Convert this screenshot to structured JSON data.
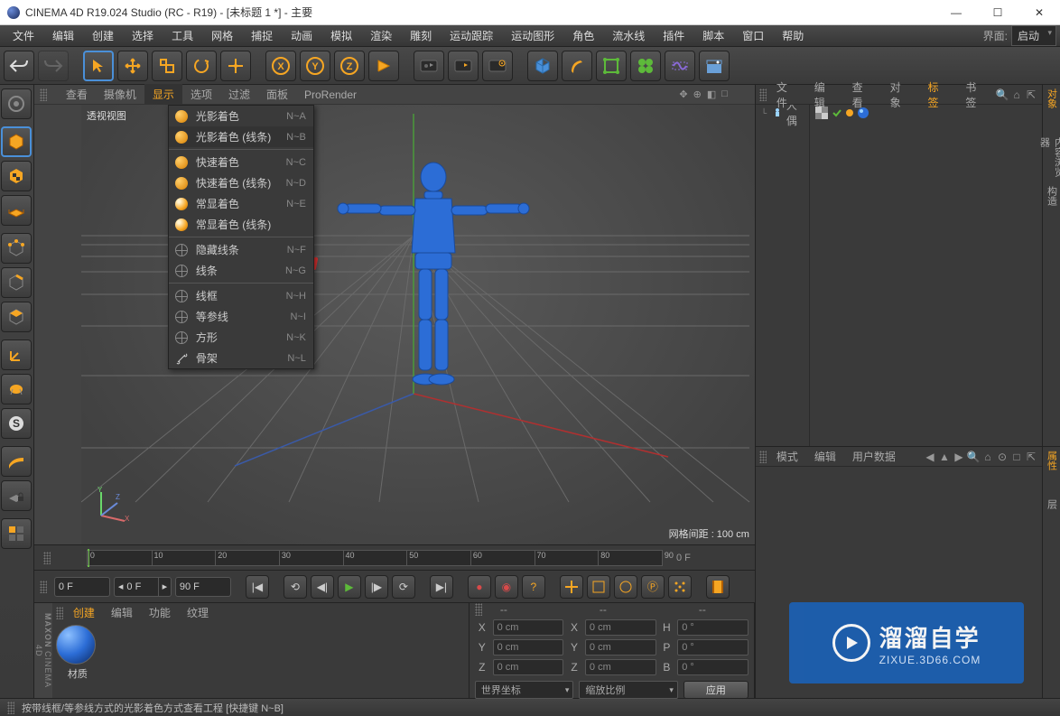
{
  "window": {
    "title": "CINEMA 4D R19.024 Studio (RC - R19) - [未标题 1 *] - 主要",
    "min": "—",
    "max": "☐",
    "close": "✕"
  },
  "menu": {
    "items": [
      "文件",
      "编辑",
      "创建",
      "选择",
      "工具",
      "网格",
      "捕捉",
      "动画",
      "模拟",
      "渲染",
      "雕刻",
      "运动跟踪",
      "运动图形",
      "角色",
      "流水线",
      "插件",
      "脚本",
      "窗口",
      "帮助"
    ],
    "iface_label": "界面:",
    "iface_value": "启动"
  },
  "vp_menu": {
    "items": [
      "查看",
      "摄像机",
      "显示",
      "选项",
      "过滤",
      "面板",
      "ProRender"
    ],
    "active": 2,
    "icons": [
      "✥",
      "⊕",
      "◧",
      "□"
    ]
  },
  "viewport": {
    "title": "透视视图",
    "grid_dist": "网格间距 : 100 cm",
    "axes": {
      "x": "X",
      "y": "Y",
      "z": "Z"
    }
  },
  "display_menu": [
    {
      "label": "光影着色",
      "short": "N~A",
      "icon": "shade",
      "checked": false
    },
    {
      "label": "光影着色 (线条)",
      "short": "N~B",
      "icon": "shade",
      "checked": true
    },
    {
      "sep": true
    },
    {
      "label": "快速着色",
      "short": "N~C",
      "icon": "shade"
    },
    {
      "label": "快速着色 (线条)",
      "short": "N~D",
      "icon": "shade"
    },
    {
      "label": "常显着色",
      "short": "N~E",
      "icon": "shadel"
    },
    {
      "label": "常显着色 (线条)",
      "short": "",
      "icon": "shadel"
    },
    {
      "sep": true
    },
    {
      "label": "隐藏线条",
      "short": "N~F",
      "icon": "globe"
    },
    {
      "label": "线条",
      "short": "N~G",
      "icon": "globe"
    },
    {
      "sep": true
    },
    {
      "label": "线框",
      "short": "N~H",
      "icon": "globe"
    },
    {
      "label": "等参线",
      "short": "N~I",
      "icon": "globe"
    },
    {
      "label": "方形",
      "short": "N~K",
      "icon": "globe"
    },
    {
      "label": "骨架",
      "short": "N~L",
      "icon": "bone"
    }
  ],
  "objects": {
    "tabs": [
      "文件",
      "编辑",
      "查看",
      "对象",
      "标签",
      "书签"
    ],
    "active": 4,
    "icons": [
      "🔍",
      "⌂",
      "⇱"
    ],
    "tree": [
      {
        "name": "人偶",
        "tags": [
          "grey-checker",
          "green-check",
          "blue-sphere"
        ]
      }
    ]
  },
  "attr": {
    "tabs": [
      "模式",
      "编辑",
      "用户数据"
    ],
    "nav": [
      "◀",
      "▲",
      "▶"
    ],
    "icons": [
      "🔍",
      "⌂",
      "⊙",
      "□",
      "⇱"
    ]
  },
  "sidetabs": [
    "对象",
    "内容浏览器",
    "构造"
  ],
  "sidetabs2": [
    "属性",
    "层"
  ],
  "timeline": {
    "ticks": [
      0,
      10,
      20,
      30,
      40,
      50,
      60,
      70,
      80,
      90
    ],
    "cursor_frame": "0 F"
  },
  "playbar": {
    "frame_start": "0 F",
    "frame_nudge": "0 F",
    "frame_end": "90 F"
  },
  "materials": {
    "tabs": [
      "创建",
      "编辑",
      "功能",
      "纹理"
    ],
    "active": 0,
    "item_label": "材质"
  },
  "coords": {
    "dashes": "--",
    "rows": [
      {
        "axis": "X",
        "pos": "0 cm",
        "size": "0 cm",
        "hlab": "H",
        "rot": "0 °"
      },
      {
        "axis": "Y",
        "pos": "0 cm",
        "size": "0 cm",
        "hlab": "P",
        "rot": "0 °"
      },
      {
        "axis": "Z",
        "pos": "0 cm",
        "size": "0 cm",
        "hlab": "B",
        "rot": "0 °"
      }
    ],
    "combo1": "世界坐标",
    "combo2": "缩放比例",
    "apply": "应用"
  },
  "status": "按带线框/等参线方式的光影着色方式查看工程 [快捷键 N~B]",
  "watermark": {
    "big": "溜溜自学",
    "small": "ZIXUE.3D66.COM"
  },
  "vbrand": "CINEMA 4D"
}
